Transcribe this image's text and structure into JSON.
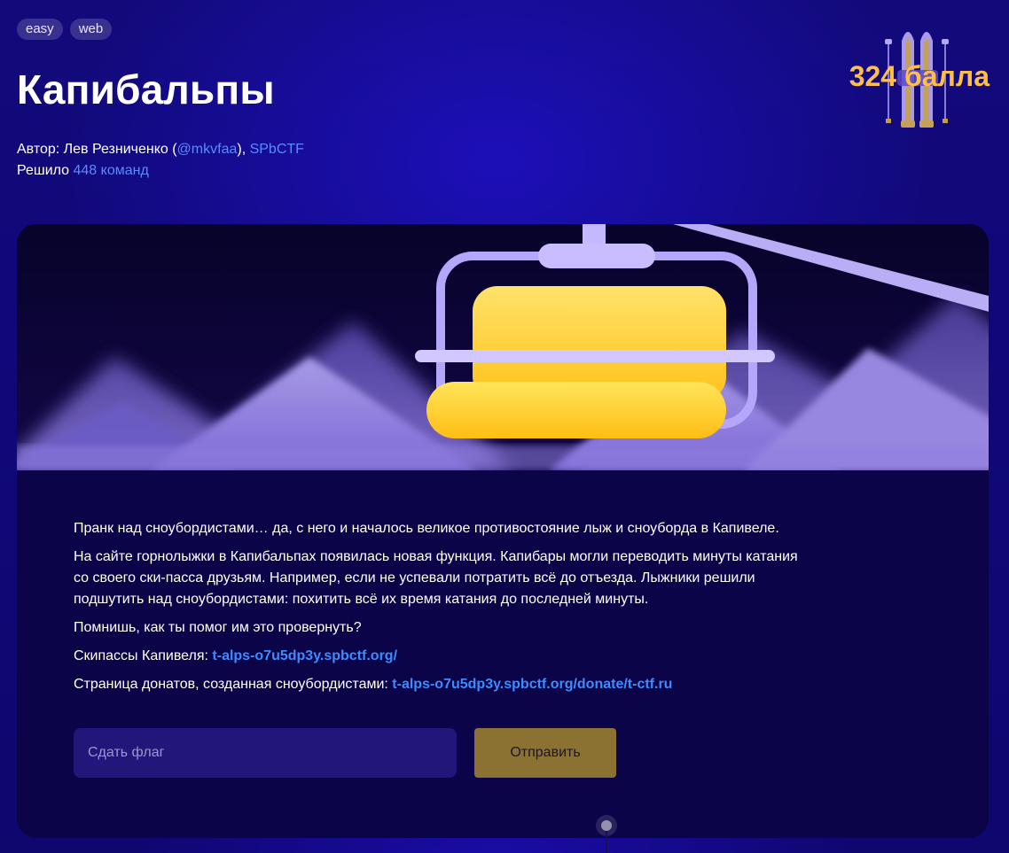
{
  "tags": [
    "easy",
    "web"
  ],
  "title": "Капибальпы",
  "author": {
    "prefix": "Автор: Лев Резниченко (",
    "handle": "@mkvfaa",
    "sep": "), ",
    "org": "SPbCTF"
  },
  "solved": {
    "prefix": "Решило ",
    "count_text": "448 команд"
  },
  "score": "324 балла",
  "description": {
    "p1": "Пранк над сноубордистами… да, с него и началось великое противостояние лыж и сноуборда в Капивеле.",
    "p2": "На сайте горнолыжки в Капибальпах появилась новая функция. Капибары могли переводить минуты катания со своего ски-пасса друзьям. Например, если не успевали потратить всё до отъезда. Лыжники решили подшутить над сноубордистами: похитить всё их время катания до последней минуты.",
    "p3": "Помнишь, как ты помог им это провернуть?",
    "skipass_label": "Скипассы Капивеля: ",
    "skipass_link": "t-alps-o7u5dp3y.spbctf.org/",
    "donate_label": "Страница донатов, созданная сноубордистами: ",
    "donate_link": "t-alps-o7u5dp3y.spbctf.org/donate/t-ctf.ru"
  },
  "flag_form": {
    "placeholder": "Сдать флаг",
    "submit_label": "Отправить"
  },
  "colors": {
    "accent_gold": "#ffbf47",
    "link_blue": "#3d8bff",
    "background": "#120a7a",
    "card": "#0b0449",
    "button": "#8b7233"
  }
}
